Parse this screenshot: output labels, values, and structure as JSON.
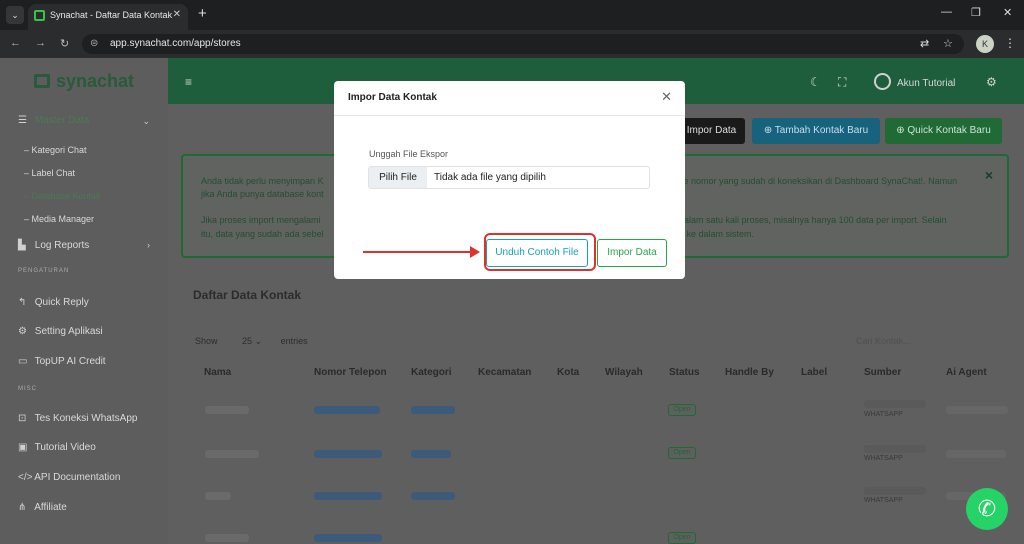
{
  "browser": {
    "tab_title": "Synachat - Daftar Data Kontak",
    "url": "app.synachat.com/app/stores",
    "new_tab": "+",
    "tab_close": "✕",
    "window_controls": [
      "—",
      "❐",
      "✕"
    ],
    "nav": [
      "←",
      "→",
      "↻"
    ],
    "kebab": "⋮",
    "profile_initial": "K"
  },
  "sidebar": {
    "brand": "synachat",
    "master": "Master Data",
    "sub_items": [
      "Kategori Chat",
      "Label Chat",
      "Database Kontak",
      "Media Manager"
    ],
    "log_reports": "Log Reports",
    "section_pengaturan": "PENGATURAN",
    "settings_items": [
      "Quick Reply",
      "Setting Aplikasi",
      "TopUP AI Credit"
    ],
    "section_misc": "MISC",
    "misc_items": [
      "Tes Koneksi WhatsApp",
      "Tutorial Video",
      "API Documentation",
      "Affiliate"
    ]
  },
  "topbar": {
    "menu_icon": "≡",
    "user_name": "Akun Tutorial"
  },
  "actions": {
    "impor_data": "Impor Data",
    "tambah": "Tambah Kontak Baru",
    "quick": "Quick Kontak Baru"
  },
  "alert": {
    "line1_left": "Anda tidak perlu menyimpan K",
    "line1_right": "ke nomor yang sudah di koneksikan di Dashboard SynaChat!. Namun",
    "line2_left": "jika Anda punya database kont",
    "line4_left": "Jika proses import mengalami",
    "line4_right": "dalam satu kali proses, misalnya hanya 100 data per import. Selain",
    "line5_left": "itu, data yang sudah ada sebel",
    "line5_right": "g ke dalam sistem.",
    "close": "×"
  },
  "table": {
    "title": "Daftar Data Kontak",
    "show_label": "Show",
    "show_value": "25",
    "entries_label": "entries",
    "search_placeholder": "Cari Kontak...",
    "columns": [
      "Nama",
      "Nomor Telepon",
      "Kategori",
      "Kecamatan",
      "Kota",
      "Wilayah",
      "Status",
      "Handle By",
      "Label",
      "Sumber",
      "Ai Agent"
    ],
    "rows": [
      {
        "status": "Open",
        "source": "WHATSAPP"
      },
      {
        "status": "Open",
        "source": "WHATSAPP"
      },
      {
        "status": "",
        "source": "WHATSAPP"
      },
      {
        "status": "Open",
        "source": ""
      }
    ]
  },
  "modal": {
    "title": "Impor Data Kontak",
    "upload_label": "Unggah File Ekspor",
    "choose_file": "Pilih File",
    "no_file": "Tidak ada file yang dipilih",
    "download_sample": "Unduh Contoh File",
    "import_button": "Impor Data"
  },
  "colors": {
    "brand_green": "#28a745",
    "info": "#17a2b8",
    "annotation": "#e03131"
  }
}
